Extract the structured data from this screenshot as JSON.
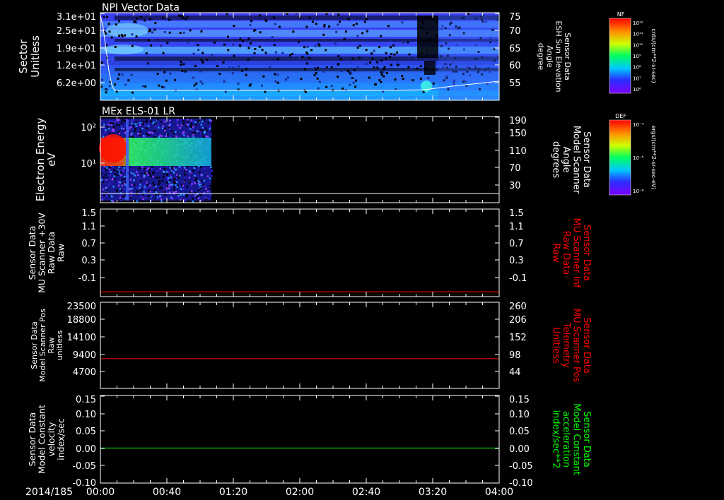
{
  "date_label": "2014/185",
  "time_ticks": [
    "00:00",
    "00:40",
    "01:20",
    "02:00",
    "02:40",
    "03:20",
    "04:00"
  ],
  "colorbars": [
    {
      "tag": "NF",
      "unit": "cnts/(cm**2-sr-sec)",
      "ticks": [
        "10¹²",
        "10¹¹",
        "10¹⁰",
        "10⁹",
        "10⁸",
        "10⁷",
        "10⁶"
      ]
    },
    {
      "tag": "DEF",
      "unit": "ergs/(cm**2-sr-sec-eV)",
      "ticks": [
        "10⁻⁴",
        "10⁻⁵",
        "10⁻⁶"
      ]
    }
  ],
  "chart_data": [
    {
      "type": "heatmap",
      "title": "NPI Vector Data",
      "ylabel": [
        "Sector",
        "Unitless"
      ],
      "yticks": [
        "3.1e+01",
        "2.5e+01",
        "1.9e+01",
        "1.2e+01",
        "6.2e+00"
      ],
      "y2label": [
        "Sensor Data",
        "ESH Sun Elevation",
        "Angle",
        "degree"
      ],
      "y2ticks": [
        "75",
        "70",
        "65",
        "60",
        "55"
      ],
      "y2color": "#ffffff",
      "line_color": "#ffffff"
    },
    {
      "type": "heatmap",
      "title": "MEx ELS-01 LR",
      "ylabel": [
        "Electron Energy",
        "eV"
      ],
      "yticks": [
        "10²",
        "10¹"
      ],
      "y2label": [
        "Sensor Data",
        "Model Scanner",
        "Angle",
        "degrees"
      ],
      "y2ticks": [
        "190",
        "150",
        "110",
        "70",
        "30"
      ],
      "y2color": "#ffffff",
      "line_color": "#ffffff",
      "data_end_time": "00:53"
    },
    {
      "type": "line",
      "ylabel": [
        "Sensor Data",
        "MU Scanner +30V",
        "Raw Data",
        "Raw"
      ],
      "yticks": [
        "1.5",
        "1.1",
        "0.7",
        "0.3",
        "-0.1"
      ],
      "y2label": [
        "Sensor Data",
        "MU Scanner Inf",
        "Raw Data",
        "Raw"
      ],
      "y2ticks": [
        "1.5",
        "1.1",
        "0.7",
        "0.3",
        "-0.1"
      ],
      "y2color": "#ff0000",
      "ylim": [
        -0.3,
        1.5
      ],
      "series": [
        {
          "color": "#ff0000",
          "y": -0.2
        }
      ]
    },
    {
      "type": "line",
      "ylabel": [
        "Sensor Data",
        "Model Scanner Pos",
        "Raw",
        "unitless"
      ],
      "yticks": [
        "23500",
        "18800",
        "14100",
        "9400",
        "4700"
      ],
      "y2label": [
        "Sensor Data",
        "MU Scanner Pos",
        "Telemetry",
        "Unitless"
      ],
      "y2ticks": [
        "260",
        "206",
        "152",
        "98",
        "44"
      ],
      "y2color": "#ff0000",
      "ylim": [
        0,
        23500
      ],
      "series": [
        {
          "color": "#ff0000",
          "y": 8100
        }
      ]
    },
    {
      "type": "line",
      "ylabel": [
        "Sensor Data",
        "Model Constant",
        "velocity",
        "index/sec"
      ],
      "yticks": [
        "0.15",
        "0.10",
        "0.05",
        "0.00",
        "-0.05",
        "-0.10"
      ],
      "y2label": [
        "Sensor Data",
        "Model Constant",
        "acceleration",
        "index/sec**2"
      ],
      "y2ticks": [
        "0.15",
        "0.10",
        "0.05",
        "0.00",
        "-0.05",
        "-0.10"
      ],
      "y2color": "#00ff00",
      "ylim": [
        -0.1,
        0.15
      ],
      "series": [
        {
          "color": "#00ff00",
          "y": 0.0
        }
      ]
    }
  ]
}
